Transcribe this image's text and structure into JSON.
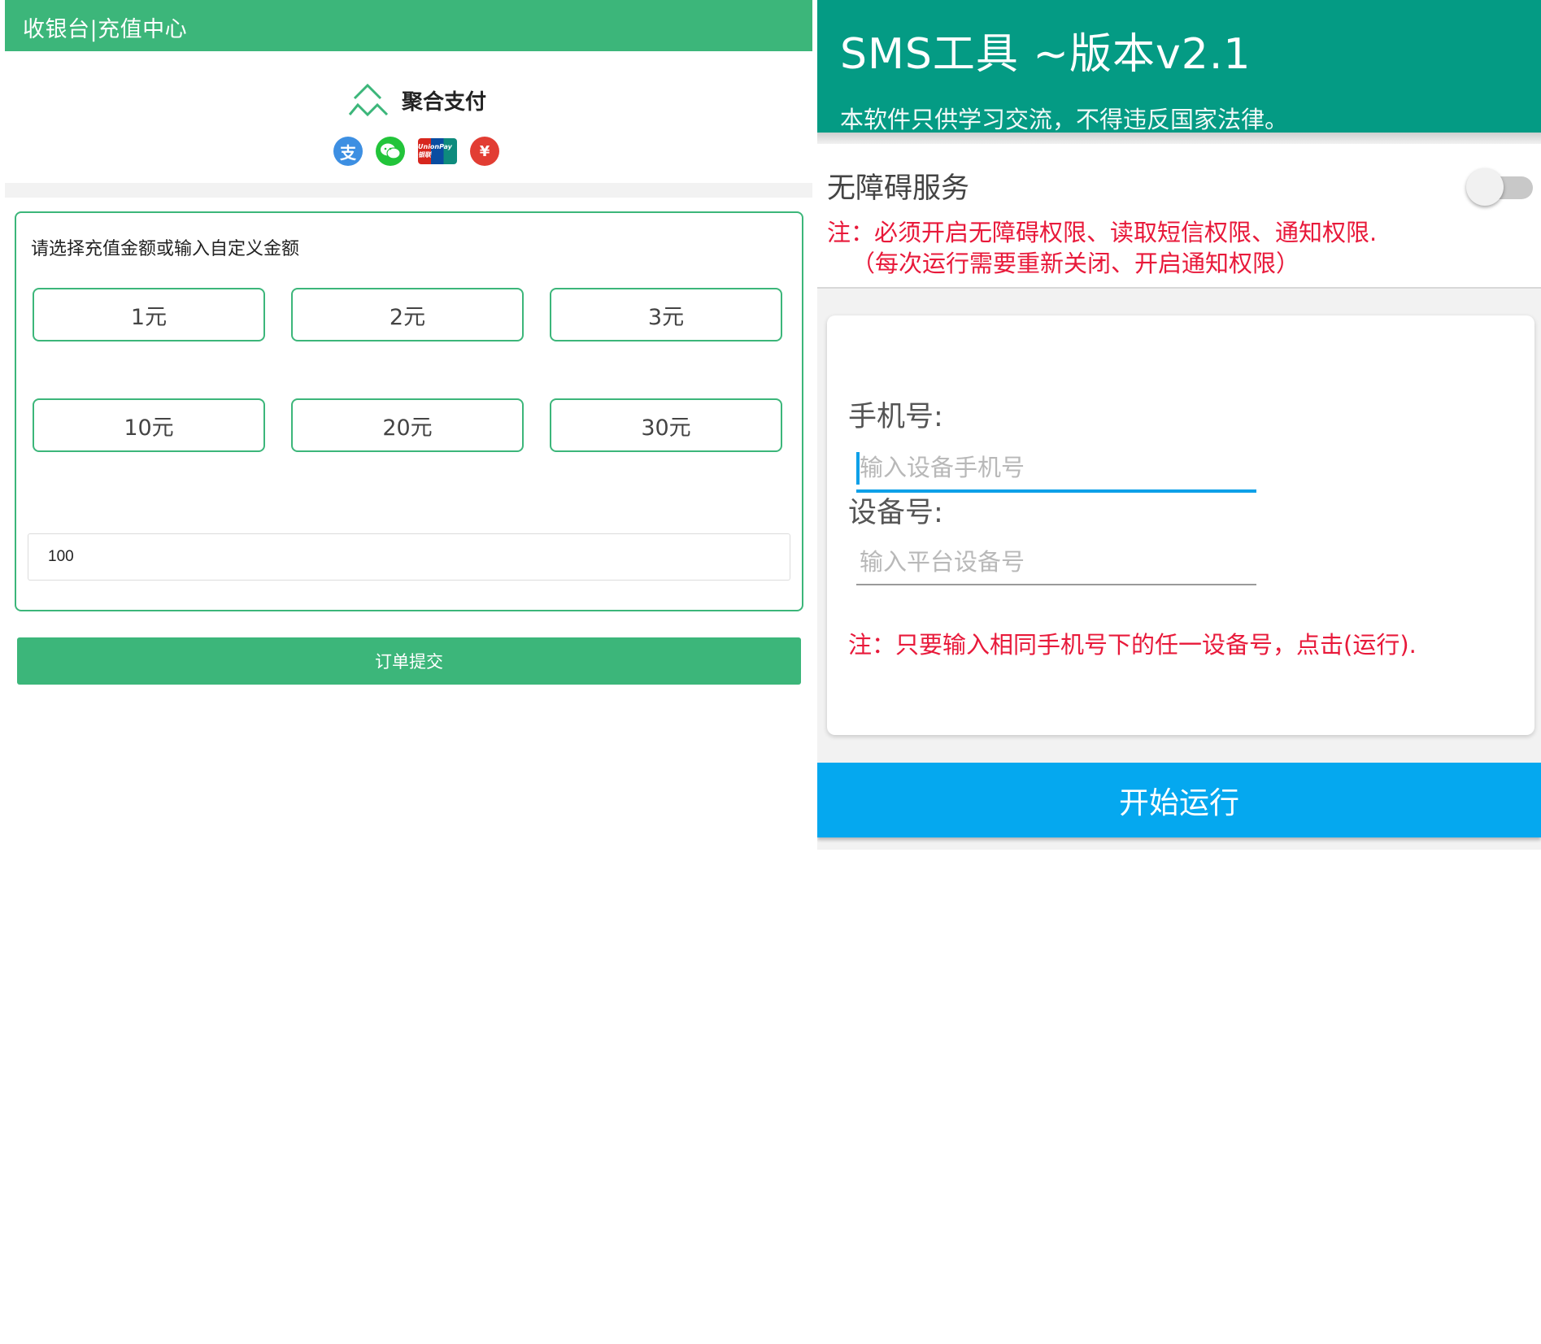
{
  "cashier": {
    "header_title": "收银台|充值中心",
    "brand_name": "聚合支付",
    "payment_methods": [
      {
        "name": "alipay",
        "glyph": "支"
      },
      {
        "name": "wechat-pay",
        "glyph": ""
      },
      {
        "name": "unionpay",
        "glyph": "UnionPay 银联"
      },
      {
        "name": "red-packet",
        "glyph": "¥"
      }
    ],
    "amount_prompt": "请选择充值金额或输入自定义金额",
    "amount_options": [
      "1元",
      "2元",
      "3元",
      "10元",
      "20元",
      "30元"
    ],
    "custom_amount_value": "100",
    "submit_label": "订单提交",
    "colors": {
      "accent": "#3cb67a"
    }
  },
  "sms_tool": {
    "title": "SMS工具 ~版本v2.1",
    "subtitle": "本软件只供学习交流，不得违反国家法律。",
    "accessibility_label": "无障碍服务",
    "accessibility_enabled": false,
    "accessibility_note_line1": "注：必须开启无障碍权限、读取短信权限、通知权限.",
    "accessibility_note_line2": "（每次运行需要重新关闭、开启通知权限）",
    "phone_label": "手机号:",
    "phone_placeholder": "输入设备手机号",
    "device_label": "设备号:",
    "device_placeholder": "输入平台设备号",
    "form_note": "注：只要输入相同手机号下的任一设备号，点击(运行).",
    "run_label": "开始运行",
    "colors": {
      "header": "#049b84",
      "button": "#05a8ef",
      "warning": "#e8193a",
      "focus": "#0ea0e8"
    }
  }
}
